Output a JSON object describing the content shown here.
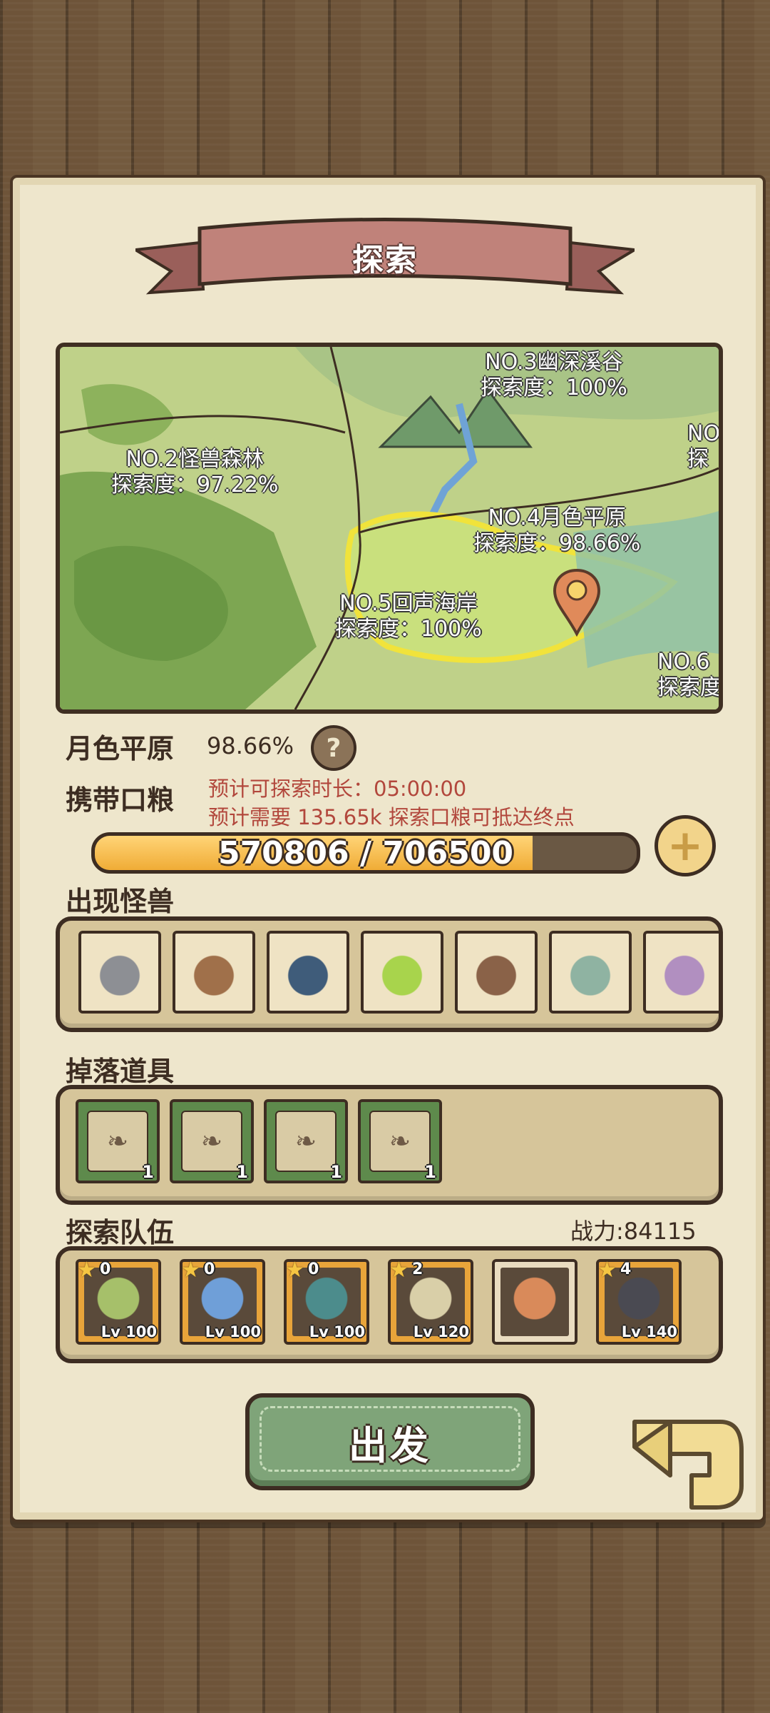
{
  "header": {
    "title": "探索"
  },
  "map": {
    "regions": [
      {
        "name": "NO.3幽深溪谷",
        "progress": "探索度：100%"
      },
      {
        "name": "NO.2怪兽森林",
        "progress": "探索度：97.22%"
      },
      {
        "name": "NO.4月色平原",
        "progress": "探索度：98.66%"
      },
      {
        "name": "NO.5回声海岸",
        "progress": "探索度：100%"
      },
      {
        "name": "NO.6",
        "progress": "探索度"
      },
      {
        "name": "NO",
        "progress": "探"
      }
    ],
    "pin_icon": "location-pin-icon"
  },
  "area": {
    "name": "月色平原",
    "progress": "98.66%",
    "help_icon": "question-icon"
  },
  "rations": {
    "label": "携带口粮",
    "duration_text": "预计可探索时长：05:00:00",
    "need_text": "预计需要 135.65k 探索口粮可抵达终点",
    "current": 570806,
    "max": 706500,
    "display": "570806 / 706500",
    "fill_fraction": 0.808,
    "add_icon": "plus-icon"
  },
  "monsters": {
    "label": "出现怪兽",
    "items": [
      {
        "icon": "ghost-girl-monster-icon",
        "color": "#8d8f94"
      },
      {
        "icon": "treasure-chest-monster-icon",
        "color": "#a0704a"
      },
      {
        "icon": "big-mouth-monster-icon",
        "color": "#3f5c7a"
      },
      {
        "icon": "green-slime-monster-icon",
        "color": "#a8d44c"
      },
      {
        "icon": "rock-golem-monster-icon",
        "color": "#8a6248"
      },
      {
        "icon": "zombie-monster-icon",
        "color": "#8fb3a2"
      },
      {
        "icon": "mushroom-monster-icon",
        "color": "#b18fc0"
      }
    ]
  },
  "drops": {
    "label": "掉落道具",
    "items": [
      {
        "icon": "scroll-map-icon",
        "qty": "1"
      },
      {
        "icon": "gift-box-icon",
        "qty": "1"
      },
      {
        "icon": "jar-icon",
        "qty": "1"
      },
      {
        "icon": "scroll-note-icon",
        "qty": "1"
      }
    ]
  },
  "team": {
    "label": "探索队伍",
    "power": "战力:84115",
    "members": [
      {
        "icon": "green-hero-avatar",
        "stars": "0",
        "level": "Lv 100",
        "color": "#a6c06a"
      },
      {
        "icon": "blue-hat-hero-avatar",
        "stars": "0",
        "level": "Lv 100",
        "color": "#6f9fd8"
      },
      {
        "icon": "teal-hero-avatar",
        "stars": "0",
        "level": "Lv 100",
        "color": "#4c8c8c"
      },
      {
        "icon": "cream-hero-avatar",
        "stars": "2",
        "level": "Lv 120",
        "color": "#d9cfa8"
      },
      {
        "icon": "orange-hair-hero-avatar",
        "stars": "",
        "level": "",
        "color": "#d98a5a"
      },
      {
        "icon": "dark-hair-hero-avatar",
        "stars": "4",
        "level": "Lv 140",
        "color": "#4a4a52"
      }
    ]
  },
  "actions": {
    "depart": "出发",
    "back_icon": "back-arrow-icon"
  }
}
